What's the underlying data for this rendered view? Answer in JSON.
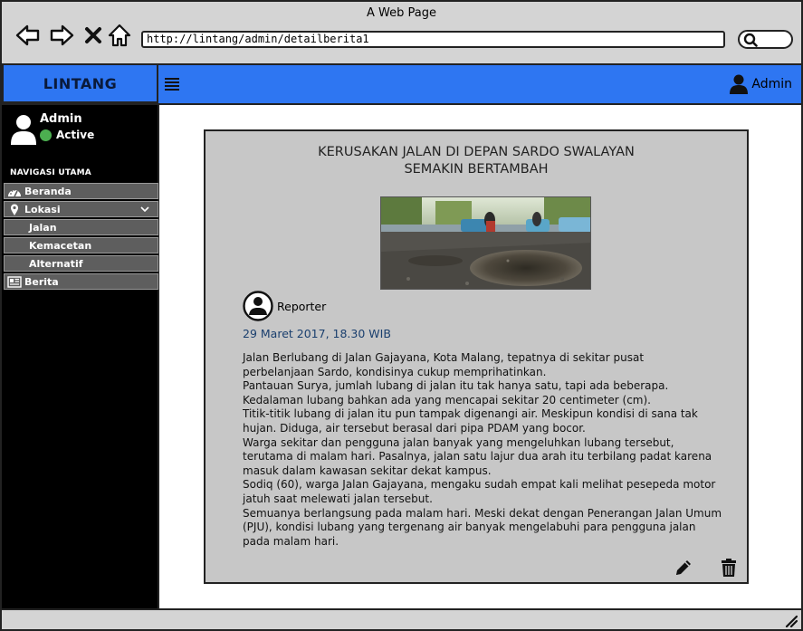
{
  "window": {
    "title": "A Web Page"
  },
  "browser": {
    "url": "http://lintang/admin/detailberita1",
    "icons": [
      "back-arrow-icon",
      "forward-arrow-icon",
      "close-x-icon",
      "home-icon",
      "search-icon"
    ]
  },
  "header": {
    "brand": "LINTANG",
    "user_label": "Admin",
    "accent_color": "#2e76f2"
  },
  "sidebar": {
    "user": {
      "name": "Admin",
      "status": "Active",
      "status_color": "#4caf50"
    },
    "nav_header": "NAVIGASI UTAMA",
    "items": [
      {
        "label": "Beranda",
        "icon": "dashboard-icon"
      },
      {
        "label": "Lokasi",
        "icon": "map-pin-icon",
        "expanded": true
      },
      {
        "label": "Jalan",
        "sub": true
      },
      {
        "label": "Kemacetan",
        "sub": true
      },
      {
        "label": "Alternatif",
        "sub": true
      },
      {
        "label": "Berita",
        "icon": "newspaper-icon"
      }
    ]
  },
  "article": {
    "title_line1": "KERUSAKAN JALAN DI DEPAN SARDO SWALAYAN",
    "title_line2": "SEMAKIN BERTAMBAH",
    "reporter": "Reporter",
    "date": "29 Maret 2017, 18.30 WIB",
    "body": [
      "Jalan Berlubang di Jalan Gajayana, Kota Malang, tepatnya di sekitar pusat",
      "perbelanjaan Sardo, kondisinya cukup memprihatinkan.",
      "Pantauan Surya, jumlah lubang di jalan itu tak hanya satu, tapi ada beberapa.",
      "Kedalaman lubang bahkan ada yang mencapai sekitar 20 centimeter (cm).",
      "Titik-titik lubang di jalan itu pun tampak digenangi air. Meskipun kondisi di sana tak",
      "hujan. Diduga, air tersebut berasal dari pipa PDAM yang bocor.",
      "Warga sekitar dan pengguna jalan banyak yang mengeluhkan lubang tersebut,",
      "terutama di malam hari. Pasalnya, jalan satu lajur dua arah itu terbilang padat karena",
      "masuk dalam kawasan sekitar dekat kampus.",
      "Sodiq (60), warga Jalan Gajayana, mengaku sudah empat kali melihat pesepeda motor",
      "jatuh saat melewati jalan tersebut.",
      "Semuanya berlangsung pada malam hari. Meski dekat dengan Penerangan Jalan Umum",
      "(PJU), kondisi lubang yang tergenang air banyak mengelabuhi para pengguna jalan",
      "pada malam hari."
    ],
    "actions": [
      "edit-pencil-icon",
      "delete-trash-icon"
    ]
  }
}
